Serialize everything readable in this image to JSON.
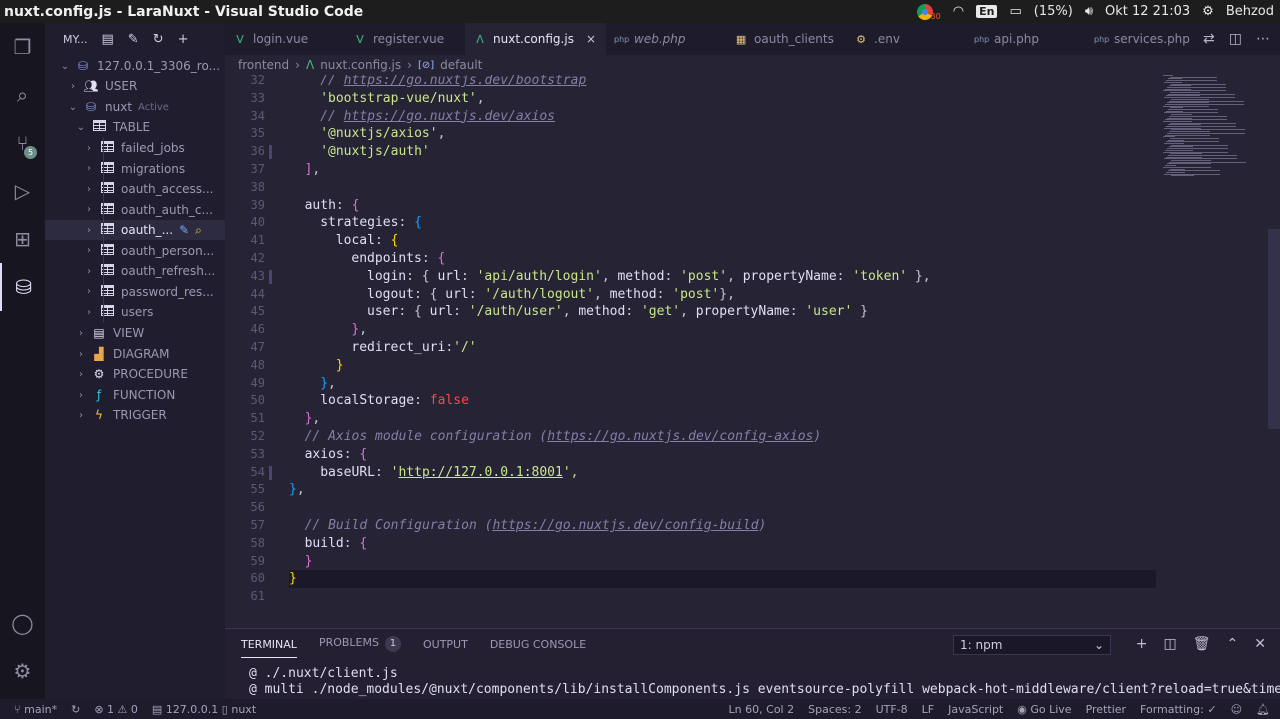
{
  "os": {
    "window_title": "nuxt.config.js - LaraNuxt - Visual Studio Code",
    "battery": "(15%)",
    "lang": "En",
    "datetime": "Okt 12 21:03",
    "user": "Behzod",
    "chrome_badge": "30"
  },
  "activity": {
    "scm_badge": "5"
  },
  "sidebar": {
    "title": "MY...",
    "connection": "127.0.0.1_3306_ro...",
    "user_label": "USER",
    "db_name": "nuxt",
    "db_status": "Active",
    "table_group": "TABLE",
    "tables": [
      "failed_jobs",
      "migrations",
      "oauth_access...",
      "oauth_auth_c...",
      "oauth_...",
      "oauth_person...",
      "oauth_refresh...",
      "password_res...",
      "users"
    ],
    "groups": [
      "VIEW",
      "DIAGRAM",
      "PROCEDURE",
      "FUNCTION",
      "TRIGGER"
    ]
  },
  "tabs": [
    {
      "label": "login.vue",
      "icon": "V",
      "color": "#41b883"
    },
    {
      "label": "register.vue",
      "icon": "V",
      "color": "#41b883"
    },
    {
      "label": "nuxt.config.js",
      "icon": "Λ",
      "color": "#41b883",
      "active": true,
      "close": "×"
    },
    {
      "label": "web.php",
      "icon": "php",
      "color": "#8993be",
      "italic": true
    },
    {
      "label": "oauth_clients",
      "icon": "▦",
      "color": "#e5c07b"
    },
    {
      "label": ".env",
      "icon": "⚙",
      "color": "#e5c07b"
    },
    {
      "label": "api.php",
      "icon": "php",
      "color": "#8993be"
    },
    {
      "label": "services.php",
      "icon": "php",
      "color": "#8993be"
    }
  ],
  "breadcrumb": {
    "folder": "frontend",
    "file": "nuxt.config.js",
    "symbol": "default"
  },
  "editor": {
    "lines": [
      {
        "n": "32",
        "indent": 4,
        "tokens": [
          [
            "cmt",
            "// "
          ],
          [
            "link",
            "https://go.nuxtjs.dev/bootstrap"
          ]
        ]
      },
      {
        "n": "33",
        "indent": 4,
        "tokens": [
          [
            "str",
            "'bootstrap-vue/nuxt'"
          ],
          [
            "pun",
            ","
          ]
        ]
      },
      {
        "n": "34",
        "indent": 4,
        "tokens": [
          [
            "cmt",
            "// "
          ],
          [
            "link",
            "https://go.nuxtjs.dev/axios"
          ]
        ]
      },
      {
        "n": "35",
        "indent": 4,
        "tokens": [
          [
            "str",
            "'@nuxtjs/axios'"
          ],
          [
            "pun",
            ","
          ]
        ]
      },
      {
        "n": "36",
        "indent": 4,
        "tokens": [
          [
            "str",
            "'@nuxtjs/auth'"
          ]
        ]
      },
      {
        "n": "37",
        "indent": 2,
        "tokens": [
          [
            "b2",
            "]"
          ],
          [
            "pun",
            ","
          ]
        ]
      },
      {
        "n": "38",
        "indent": 0,
        "tokens": []
      },
      {
        "n": "39",
        "indent": 2,
        "tokens": [
          [
            "key",
            "auth"
          ],
          [
            "pun",
            ": "
          ],
          [
            "b2",
            "{"
          ]
        ]
      },
      {
        "n": "40",
        "indent": 4,
        "tokens": [
          [
            "key",
            "strategies"
          ],
          [
            "pun",
            ": "
          ],
          [
            "b3",
            "{"
          ]
        ]
      },
      {
        "n": "41",
        "indent": 6,
        "tokens": [
          [
            "key",
            "local"
          ],
          [
            "pun",
            ": "
          ],
          [
            "b1",
            "{"
          ]
        ]
      },
      {
        "n": "42",
        "indent": 8,
        "tokens": [
          [
            "key",
            "endpoints"
          ],
          [
            "pun",
            ": "
          ],
          [
            "b2",
            "{"
          ]
        ]
      },
      {
        "n": "43",
        "indent": 10,
        "tokens": [
          [
            "key",
            "login"
          ],
          [
            "pun",
            ": { "
          ],
          [
            "key",
            "url"
          ],
          [
            "pun",
            ": "
          ],
          [
            "str",
            "'api/auth/login'"
          ],
          [
            "pun",
            ", "
          ],
          [
            "key",
            "method"
          ],
          [
            "pun",
            ": "
          ],
          [
            "str",
            "'post'"
          ],
          [
            "pun",
            ", "
          ],
          [
            "key",
            "propertyName"
          ],
          [
            "pun",
            ": "
          ],
          [
            "str",
            "'token'"
          ],
          [
            "pun",
            " },"
          ]
        ]
      },
      {
        "n": "44",
        "indent": 10,
        "tokens": [
          [
            "key",
            "logout"
          ],
          [
            "pun",
            ": { "
          ],
          [
            "key",
            "url"
          ],
          [
            "pun",
            ": "
          ],
          [
            "str",
            "'/auth/logout'"
          ],
          [
            "pun",
            ", "
          ],
          [
            "key",
            "method"
          ],
          [
            "pun",
            ": "
          ],
          [
            "str",
            "'post'"
          ],
          [
            "pun",
            "},"
          ]
        ]
      },
      {
        "n": "45",
        "indent": 10,
        "tokens": [
          [
            "key",
            "user"
          ],
          [
            "pun",
            ": { "
          ],
          [
            "key",
            "url"
          ],
          [
            "pun",
            ": "
          ],
          [
            "str",
            "'/auth/user'"
          ],
          [
            "pun",
            ", "
          ],
          [
            "key",
            "method"
          ],
          [
            "pun",
            ": "
          ],
          [
            "str",
            "'get'"
          ],
          [
            "pun",
            ", "
          ],
          [
            "key",
            "propertyName"
          ],
          [
            "pun",
            ": "
          ],
          [
            "str",
            "'user'"
          ],
          [
            "pun",
            " }"
          ]
        ]
      },
      {
        "n": "46",
        "indent": 8,
        "tokens": [
          [
            "b2",
            "}"
          ],
          [
            "pun",
            ","
          ]
        ]
      },
      {
        "n": "47",
        "indent": 8,
        "tokens": [
          [
            "key",
            "redirect_uri"
          ],
          [
            "pun",
            ":"
          ],
          [
            "str",
            "'/'"
          ]
        ]
      },
      {
        "n": "48",
        "indent": 6,
        "tokens": [
          [
            "b1",
            "}"
          ]
        ]
      },
      {
        "n": "49",
        "indent": 4,
        "tokens": [
          [
            "b3",
            "}"
          ],
          [
            "pun",
            ","
          ]
        ]
      },
      {
        "n": "50",
        "indent": 4,
        "tokens": [
          [
            "key",
            "localStorage"
          ],
          [
            "pun",
            ": "
          ],
          [
            "bool",
            "false"
          ]
        ]
      },
      {
        "n": "51",
        "indent": 2,
        "tokens": [
          [
            "b2",
            "}"
          ],
          [
            "pun",
            ","
          ]
        ]
      },
      {
        "n": "52",
        "indent": 2,
        "tokens": [
          [
            "cmt",
            "// Axios module configuration ("
          ],
          [
            "link",
            "https://go.nuxtjs.dev/config-axios"
          ],
          [
            "cmt",
            ")"
          ]
        ]
      },
      {
        "n": "53",
        "indent": 2,
        "tokens": [
          [
            "key",
            "axios"
          ],
          [
            "pun",
            ": "
          ],
          [
            "b2",
            "{"
          ]
        ]
      },
      {
        "n": "54",
        "indent": 4,
        "tokens": [
          [
            "key",
            "baseURL"
          ],
          [
            "pun",
            ": "
          ],
          [
            "str",
            "'"
          ],
          [
            "url",
            "http://127.0.0.1:8001"
          ],
          [
            "str",
            "'"
          ],
          [
            "pun",
            ","
          ]
        ]
      },
      {
        "n": "55",
        "indent": 0,
        "tokens": [
          [
            "b3",
            "}"
          ],
          [
            "pun",
            ","
          ]
        ]
      },
      {
        "n": "56",
        "indent": 0,
        "tokens": []
      },
      {
        "n": "57",
        "indent": 2,
        "tokens": [
          [
            "cmt",
            "// Build Configuration ("
          ],
          [
            "link",
            "https://go.nuxtjs.dev/config-build"
          ],
          [
            "cmt",
            ")"
          ]
        ]
      },
      {
        "n": "58",
        "indent": 2,
        "tokens": [
          [
            "key",
            "build"
          ],
          [
            "pun",
            ": "
          ],
          [
            "b2",
            "{"
          ]
        ]
      },
      {
        "n": "59",
        "indent": 2,
        "tokens": [
          [
            "b2",
            "}"
          ]
        ]
      },
      {
        "n": "60",
        "indent": 0,
        "tokens": [
          [
            "b1",
            "}"
          ]
        ]
      },
      {
        "n": "61",
        "indent": 0,
        "tokens": []
      }
    ]
  },
  "panel": {
    "tabs": [
      "TERMINAL",
      "PROBLEMS",
      "OUTPUT",
      "DEBUG CONSOLE"
    ],
    "problems_count": "1",
    "terminal_select": "1: npm",
    "terminal_lines": [
      "@ ./.nuxt/client.js",
      "@ multi ./node_modules/@nuxt/components/lib/installComponents.js eventsource-polyfill webpack-hot-middleware/client?reload=true&timeout"
    ]
  },
  "statusbar": {
    "branch": "main*",
    "errors": "1",
    "warnings": "0",
    "connection": "127.0.0.1",
    "db": "nuxt",
    "position": "Ln 60, Col 2",
    "spaces": "Spaces: 2",
    "encoding": "UTF-8",
    "eol": "LF",
    "language": "JavaScript",
    "golive": "Go Live",
    "prettier": "Prettier",
    "formatting": "Formatting: ✓"
  }
}
